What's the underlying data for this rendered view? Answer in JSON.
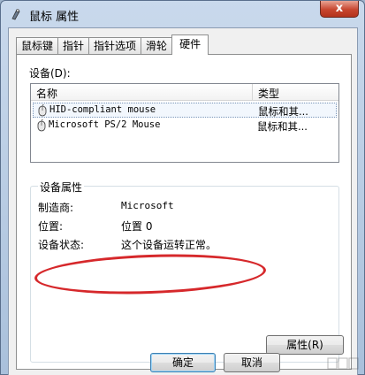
{
  "window": {
    "title": "鼠标 属性",
    "close_label": "x"
  },
  "tabs": [
    {
      "label": "鼠标键",
      "active": false
    },
    {
      "label": "指针",
      "active": false
    },
    {
      "label": "指针选项",
      "active": false
    },
    {
      "label": "滑轮",
      "active": false
    },
    {
      "label": "硬件",
      "active": true
    }
  ],
  "devices": {
    "label": "设备(D):",
    "columns": {
      "name": "名称",
      "type": "类型"
    },
    "rows": [
      {
        "name": "HID-compliant mouse",
        "type": "鼠标和其...",
        "selected": true
      },
      {
        "name": "Microsoft PS/2 Mouse",
        "type": "鼠标和其...",
        "selected": false
      }
    ]
  },
  "properties": {
    "title": "设备属性",
    "manufacturer_label": "制造商:",
    "manufacturer_value": "Microsoft",
    "location_label": "位置:",
    "location_value": "位置 0",
    "status_label": "设备状态:",
    "status_value": "这个设备运转正常。",
    "properties_button": "属性(R)"
  },
  "footer": {
    "ok_label": "确定",
    "cancel_label": "取消"
  },
  "colors": {
    "annotation": "#d6282b",
    "accent": "#3c7fb1"
  }
}
